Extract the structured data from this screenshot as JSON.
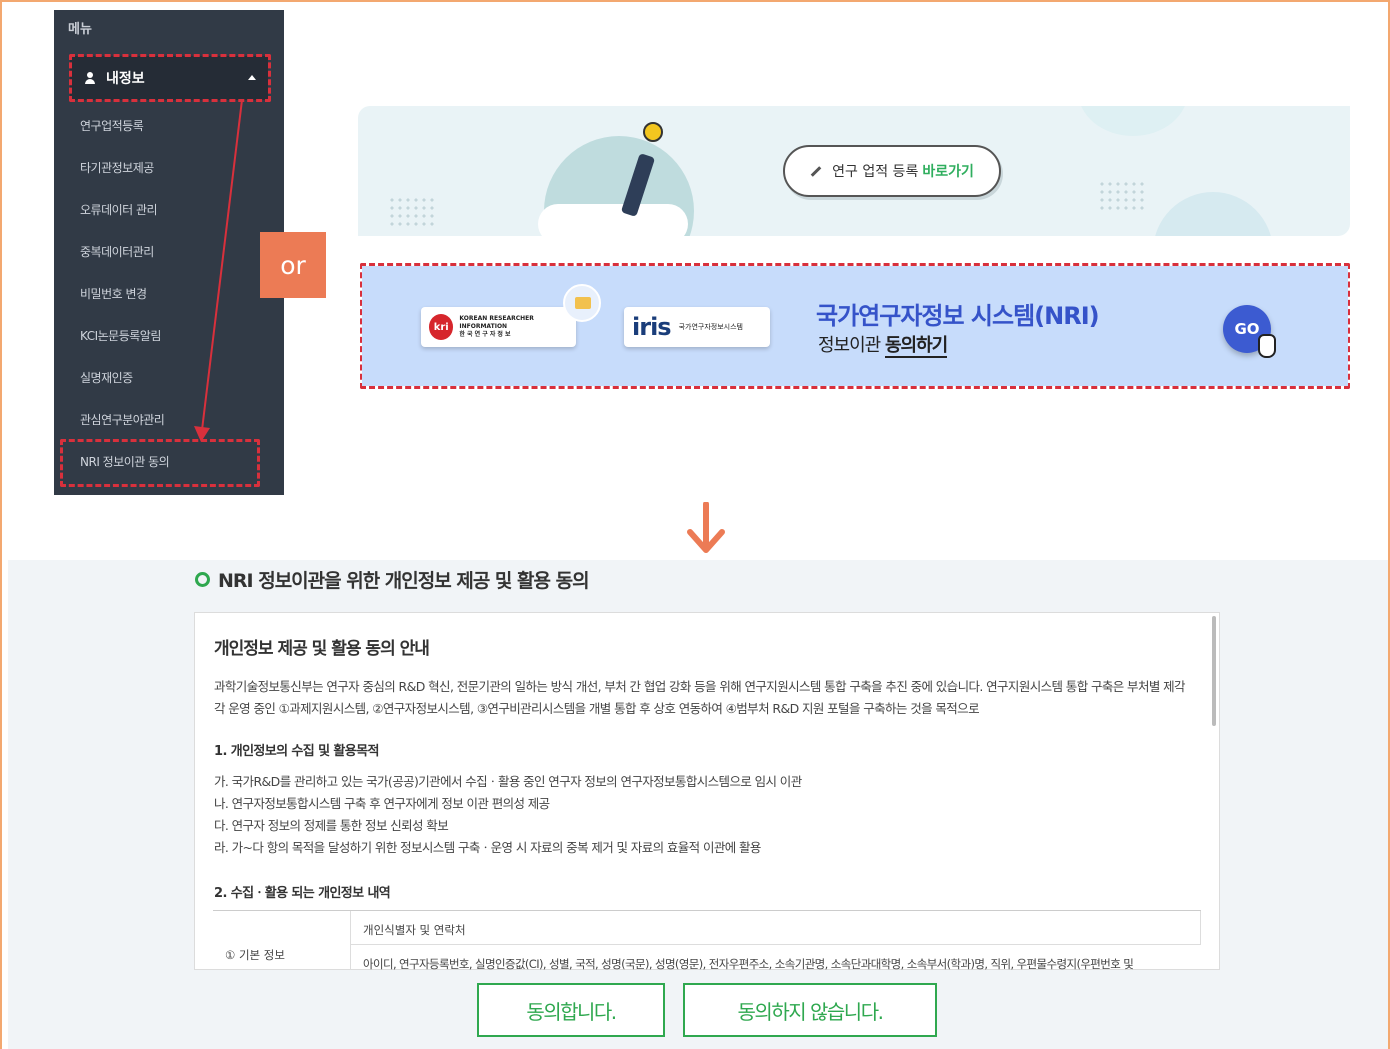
{
  "sidebar": {
    "title": "메뉴",
    "section_label": "내정보",
    "items": [
      {
        "label": "연구업적등록"
      },
      {
        "label": "타기관정보제공"
      },
      {
        "label": "오류데이터 관리"
      },
      {
        "label": "중복데이터관리"
      },
      {
        "label": "비밀번호 변경"
      },
      {
        "label": "KCI논문등록알림"
      },
      {
        "label": "실명재인증"
      },
      {
        "label": "관심연구분야관리"
      },
      {
        "label": "NRI 정보이관 동의"
      }
    ]
  },
  "or_label": "or",
  "banner_research": {
    "button_text": "연구 업적 등록",
    "button_link": "바로가기"
  },
  "banner_nri": {
    "kri_logo_letters": "kri",
    "kri_logo_text": "KOREAN RESEARCHER INFORMATION",
    "kri_logo_korean": "한 국 연 구 자 정 보",
    "iris_logo": "iris",
    "iris_sub": "국가연구자정보시스템",
    "title": "국가연구자정보 시스템(NRI)",
    "subtitle_prefix": "정보이관 ",
    "subtitle_bold": "동의하기",
    "go_label": "GO"
  },
  "consent": {
    "section_title": "NRI 정보이관을 위한 개인정보 제공 및 활용 동의",
    "heading": "개인정보 제공 및 활용 동의 안내",
    "paragraph": "과학기술정보통신부는 연구자 중심의 R&D 혁신, 전문기관의 일하는 방식 개선, 부처 간 협업 강화 등을 위해 연구지원시스템 통합 구축을 추진 중에 있습니다. 연구지원시스템 통합 구축은 부처별 제각각 운영 중인 ①과제지원시스템, ②연구자정보시스템, ③연구비관리시스템을 개별 통합 후 상호 연동하여 ④범부처 R&D 지원 포털을 구축하는 것을 목적으로",
    "sub1": "1. 개인정보의 수집 및 활용목적",
    "lines": [
      "가. 국가R&D를 관리하고 있는 국가(공공)기관에서 수집ㆍ활용 중인 연구자 정보의 연구자정보통합시스템으로 임시 이관",
      "나. 연구자정보통합시스템 구축 후 연구자에게 정보 이관 편의성 제공",
      "다. 연구자 정보의 정제를 통한 정보 신뢰성 확보",
      "라. 가~다 항의 목적을 달성하기 위한 정보시스템 구축ㆍ운영 시 자료의 중복 제거 및 자료의 효율적 이관에 활용"
    ],
    "sub2": "2. 수집ㆍ활용 되는 개인정보 내역",
    "table": {
      "row_head": "① 기본 정보",
      "r1": "개인식별자 및 연락처",
      "r2": "아이디, 연구자등록번호, 실명인증값(CI), 성별, 국적, 성명(국문), 성명(영문), 전자우편주소, 소속기관명, 소속단과대학명, 소속부서(학과)명, 직위, 우편물수령지(우편번호 및"
    },
    "agree_label": "동의합니다.",
    "disagree_label": "동의하지 않습니다."
  },
  "colors": {
    "accent_red": "#d8303c",
    "accent_green": "#2fa84f",
    "nri_blue": "#3553c9",
    "or_orange": "#ec7b55"
  }
}
